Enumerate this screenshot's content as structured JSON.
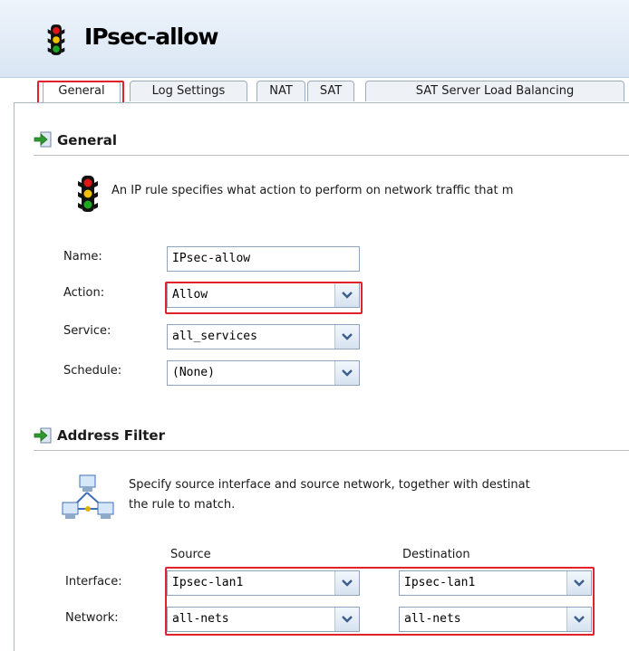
{
  "window": {
    "title": "IPsec-allow"
  },
  "tabs": [
    "General",
    "Log Settings",
    "NAT",
    "SAT",
    "SAT Server Load Balancing"
  ],
  "general": {
    "heading": "General",
    "description": "An IP rule specifies what action to perform on network traffic that m",
    "name_label": "Name:",
    "name_value": "IPsec-allow",
    "action_label": "Action:",
    "action_value": "Allow",
    "service_label": "Service:",
    "service_value": "all_services",
    "schedule_label": "Schedule:",
    "schedule_value": "(None)"
  },
  "address_filter": {
    "heading": "Address Filter",
    "description_line1": "Specify source interface and source network, together with destinat",
    "description_line2": "the rule to match.",
    "source_header": "Source",
    "destination_header": "Destination",
    "interface_label": "Interface:",
    "network_label": "Network:",
    "source_interface": "Ipsec-lan1",
    "destination_interface": "Ipsec-lan1",
    "source_network": "all-nets",
    "destination_network": "all-nets"
  },
  "colors": {
    "highlight": "#e0222a",
    "header_bg": "#d9e6f4",
    "arrow": "#2e9a2e"
  }
}
